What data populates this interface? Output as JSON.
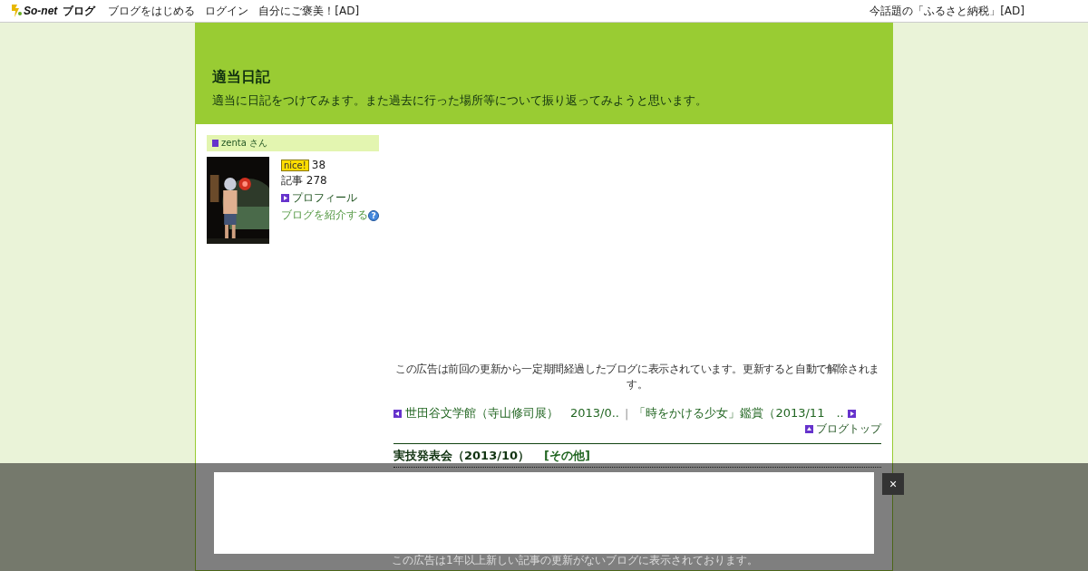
{
  "topbar": {
    "logo": {
      "brand": "So-net",
      "service": "ブログ"
    },
    "links": [
      "ブログをはじめる",
      "ログイン",
      "自分にご褒美！[AD]"
    ],
    "right_link": "今話題の「ふるさと納税」[AD]"
  },
  "header": {
    "title": "適当日記",
    "description": "適当に日記をつけてみます。また過去に行った場所等について振り返ってみようと思います。"
  },
  "profile": {
    "user": "zenta さん",
    "nice_badge": "nice!",
    "nice_count": "38",
    "articles": "記事 278",
    "profile_link": "プロフィール",
    "share_link": "ブログを紹介する",
    "help_icon": "?"
  },
  "ad_notice": "この広告は前回の更新から一定期間経過したブログに表示されています。更新すると自動で解除されます。",
  "nav": {
    "prev": "世田谷文学館（寺山修司展）　2013/0..",
    "separator": "|",
    "next": "「時をかける少女」鑑賞（2013/11　..",
    "top": "ブログトップ"
  },
  "article": {
    "title": "実技発表会（2013/10）",
    "category": "[その他]"
  },
  "overlay": {
    "close": "×",
    "notice": "この広告は1年以上新しい記事の更新がないブログに表示されております。"
  }
}
